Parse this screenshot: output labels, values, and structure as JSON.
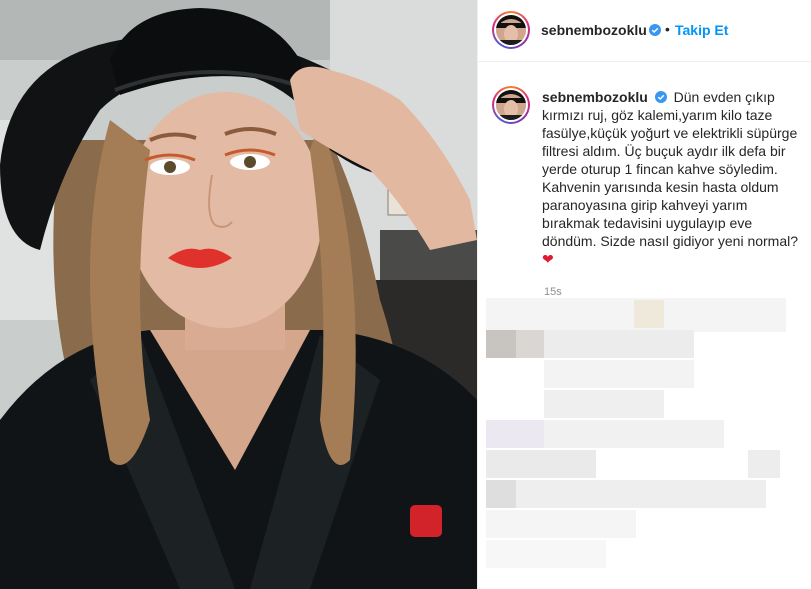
{
  "header": {
    "username": "sebnembozoklu",
    "separator": "•",
    "follow_label": "Takip Et",
    "more_icon": "more-icon"
  },
  "caption": {
    "username": "sebnembozoklu",
    "text": "Dün evden çıkıp kırmızı ruj, göz kalemi,yarım kilo taze fasülye,küçük yoğurt ve elektrikli süpürge filtresi aldım. Üç buçuk aydır ilk defa bir yerde oturup 1 fincan kahve söyledim. Kahvenin yarısında kesin hasta oldum paranoyasına girip kahveyi yarım bırakmak tedavisini uygulayıp eve döndüm. Sizde nasıl gidiyor yeni normal?",
    "emoji": "❤"
  },
  "timestamp": "15s",
  "colors": {
    "follow": "#0095f6",
    "verified": "#3897f0",
    "heart": "#e01b2f",
    "text": "#262626",
    "muted": "#8e8e8e"
  }
}
